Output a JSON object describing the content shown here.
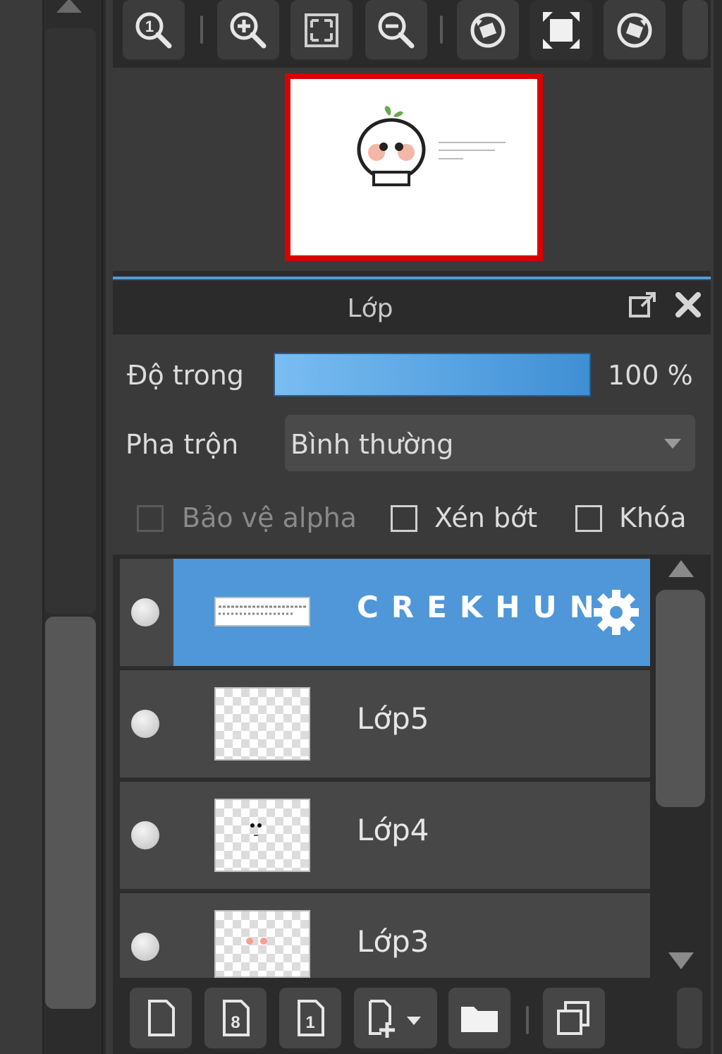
{
  "navigator": {
    "toolbar": [
      {
        "name": "zoom-actual-icon"
      },
      {
        "name": "zoom-in-icon"
      },
      {
        "name": "fit-screen-icon"
      },
      {
        "name": "zoom-out-icon"
      },
      {
        "name": "rotate-left-icon"
      },
      {
        "name": "reset-view-icon"
      },
      {
        "name": "rotate-right-icon"
      }
    ],
    "frame_color": "#d90000"
  },
  "layer_panel": {
    "title": "Lớp",
    "opacity": {
      "label": "Độ trong",
      "value": 100,
      "value_text": "100 %"
    },
    "blend": {
      "label": "Pha trộn",
      "selected": "Bình thường"
    },
    "checkboxes": [
      {
        "label": "Bảo vệ alpha",
        "checked": false,
        "enabled": false
      },
      {
        "label": "Xén bớt",
        "checked": false,
        "enabled": true
      },
      {
        "label": "Khóa",
        "checked": false,
        "enabled": true
      }
    ],
    "layers": [
      {
        "name": "CREKHUN",
        "selected": true
      },
      {
        "name": "Lớp5",
        "selected": false
      },
      {
        "name": "Lớp4",
        "selected": false
      },
      {
        "name": "Lớp3",
        "selected": false
      }
    ],
    "bottom_toolbar": [
      {
        "name": "new-layer-icon"
      },
      {
        "name": "new-8bit-layer-icon"
      },
      {
        "name": "new-1bit-layer-icon"
      },
      {
        "name": "add-layer-dropdown-icon"
      },
      {
        "name": "new-folder-icon"
      },
      {
        "name": "duplicate-layer-icon"
      }
    ]
  },
  "colors": {
    "accent": "#4f97d8",
    "panel_bg": "#3a3a3a"
  }
}
